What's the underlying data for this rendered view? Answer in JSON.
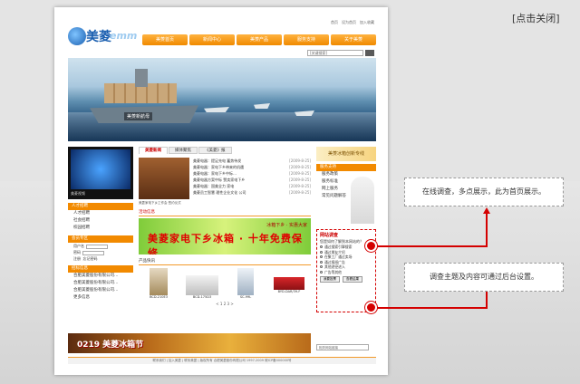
{
  "close_label": "[点击关闭]",
  "site": {
    "logo_cn": "美菱",
    "logo_en": "emm",
    "top_links": [
      "首页",
      "设为首页",
      "加入收藏"
    ],
    "nav": [
      "美菱首页",
      "新闻中心",
      "美菱产品",
      "服务支持",
      "关于美菱"
    ],
    "search_placeholder": "[关键搜索]",
    "banner_caption": "美菱新航母",
    "video_caption": "美菱视频",
    "left_sections": [
      {
        "title": "人才招聘",
        "items": [
          "人才招聘",
          "社会招聘",
          "校园招聘"
        ]
      },
      {
        "title": "会员专区",
        "items": [
          "用户名",
          "密码",
          "注册",
          "忘记密码"
        ]
      },
      {
        "title": "招标信息",
        "items": [
          "合肥美菱股份有限公司…",
          "合肥美菱股份有限公司…",
          "合肥美菱股份有限公司…",
          "更多信息"
        ]
      }
    ],
    "tabs": [
      "美菱新闻",
      "媒体聚焦",
      "《美菱》报"
    ],
    "news": [
      {
        "title": "美菱电器：提足充电 蓄势待发",
        "date": "[2009-8-25]"
      },
      {
        "title": "美菱电器：家电下乡带来的机遇",
        "date": "[2009-8-25]"
      },
      {
        "title": "美菱电器：家电下乡中标…",
        "date": "[2009-8-25]"
      },
      {
        "title": "美菱电器方案中标 赞卖家电下乡",
        "date": "[2009-8-25]"
      },
      {
        "title": "美菱电器：国美全力 家电",
        "date": "[2009-8-25]"
      },
      {
        "title": "美菱员工智慧 理性企业文化 公司",
        "date": "[2009-8-25]"
      }
    ],
    "news_img_caption": "美菱家电下乡工作会 签约仪式",
    "activity_title": "活动信息",
    "ad_text": "美菱家电下乡冰箱 · 十年免费保修",
    "ad_sub": "冰箱下乡 · 实惠大家",
    "product_title": "产品快讯",
    "products": [
      {
        "name": "BCD-210E3"
      },
      {
        "name": "BCD-175D3"
      },
      {
        "name": "SC-99L"
      },
      {
        "name": "BYD-DAR/39-F"
      }
    ],
    "pager": "< 1 2 3 >",
    "fridge_label": "美菱冰箱创新专线",
    "service_title": "服务支持",
    "service_items": [
      "服务政策",
      "服务标准",
      "网上服务",
      "常见问题解答"
    ],
    "survey": {
      "title": "网站调查",
      "question": "您是如何了解到本网站的？",
      "options": [
        "通过搜索引擎搜索",
        "通过朋友介绍",
        "在聚工厂通过卖场",
        "通过报纸广告",
        "其他途径进入",
        "广告等其他"
      ],
      "vote_label": "我要投票",
      "view_label": "查看结果"
    },
    "select_label": "相关网站链接",
    "bottom_banner": "0219 美菱冰箱节",
    "footer": "联系我们 | 加入美菱 | 联系美菱 | 版权所有 合肥美菱股份有限公司 1997-2009 皖ICP备000000号"
  },
  "callouts": [
    {
      "text": "在线调查，多点展示，此为首页展示。"
    },
    {
      "text": "调查主题及内容可通过后台设置。"
    }
  ],
  "colors": {
    "accent": "#f28a00",
    "marker": "#d40000"
  }
}
